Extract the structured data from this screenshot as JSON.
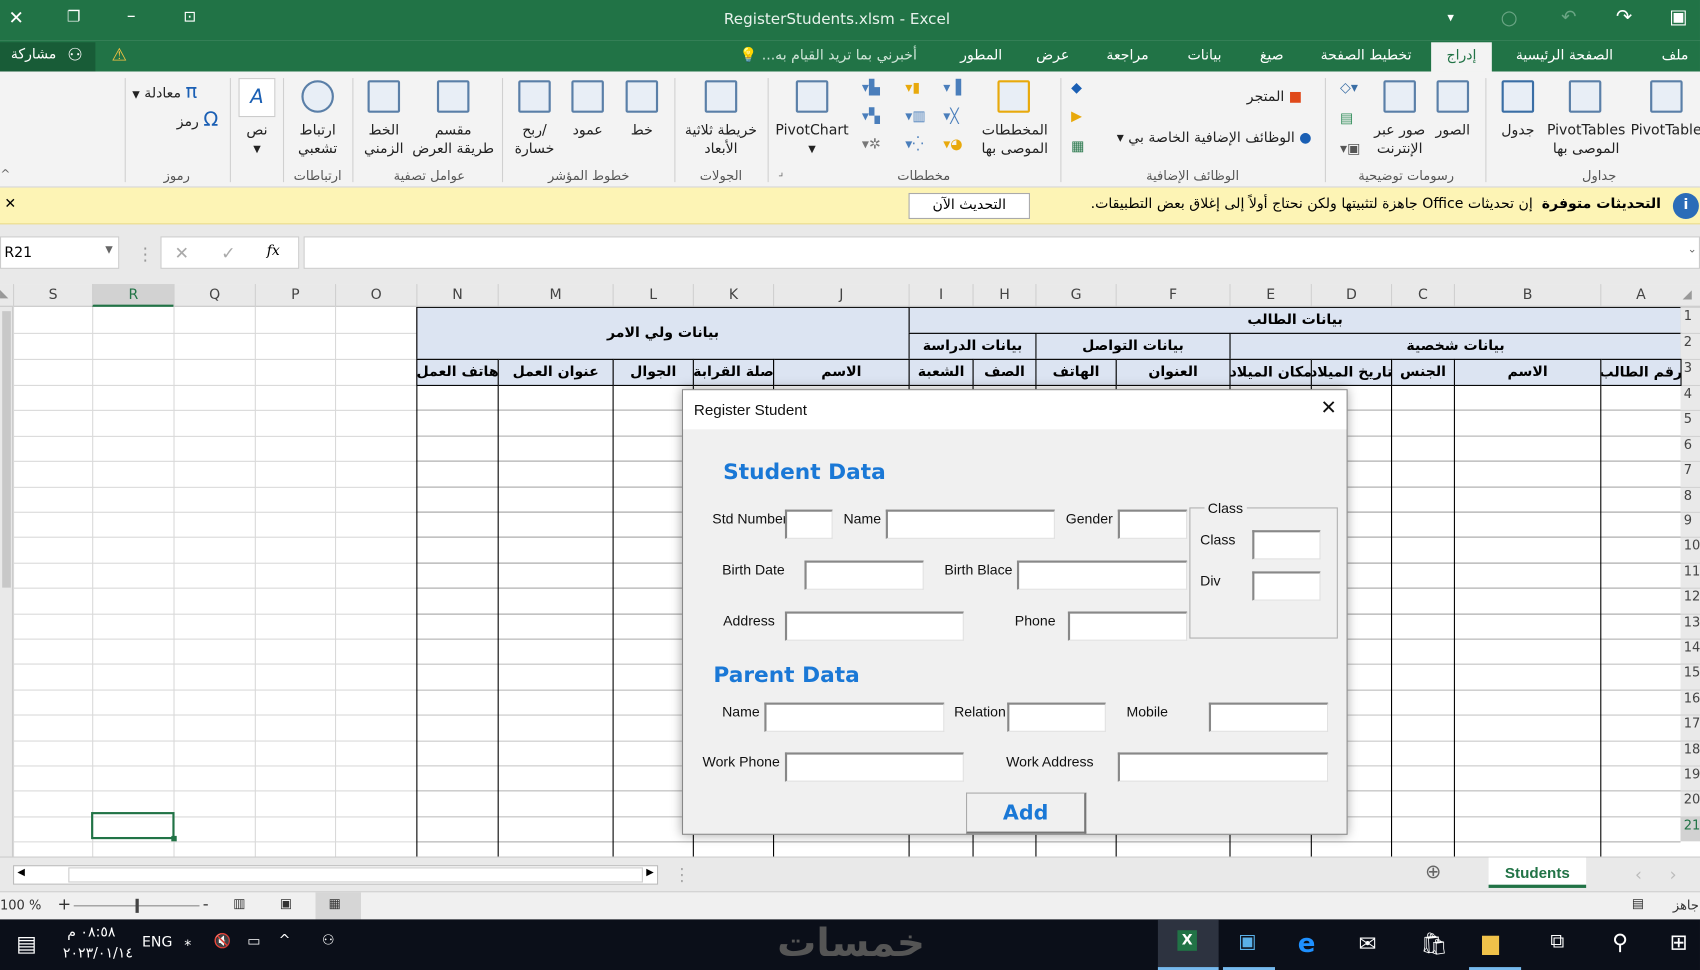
{
  "window": {
    "title": "RegisterStudents.xlsm - Excel"
  },
  "tabs": [
    {
      "label": "ملف"
    },
    {
      "label": "الصفحة الرئيسية"
    },
    {
      "label": "إدراج",
      "selected": true
    },
    {
      "label": "تخطيط الصفحة"
    },
    {
      "label": "صيغ"
    },
    {
      "label": "بيانات"
    },
    {
      "label": "مراجعة"
    },
    {
      "label": "عرض"
    },
    {
      "label": "المطور"
    }
  ],
  "tell_me": "أخبرني بما تريد القيام به...",
  "share": "مشاركة",
  "ribbon": {
    "groups": [
      "جداول",
      "رسومات توضيحية",
      "الوظائف الإضافية",
      "مخططات",
      "الجولات",
      "خطوط المؤشر",
      "عوامل تصفية",
      "ارتباطات",
      "رموز"
    ],
    "buttons": {
      "pivottable": "PivotTable",
      "rec_pivot1": "PivotTables",
      "rec_pivot2": "الموصى بها",
      "table": "جدول",
      "pictures": "الصور",
      "online1": "صور عبر",
      "online2": "الإنترنت",
      "store": "المتجر",
      "myaddins": "الوظائف الإضافية الخاصة بي",
      "rec_charts1": "المخططات",
      "rec_charts2": "الموصى بها",
      "pivotchart": "PivotChart",
      "map1": "خريطة ثلاثية",
      "map2": "الأبعاد",
      "line": "خط",
      "column": "عمود",
      "winloss1": "ربح/",
      "winloss2": "خسارة",
      "slicer1": "مقسم",
      "slicer2": "طريقة العرض",
      "timeline1": "الخط",
      "timeline2": "الزمني",
      "link1": "ارتباط",
      "link2": "تشعبي",
      "text": "نص",
      "equation": "معادلة",
      "symbol": "رمز"
    }
  },
  "banner": {
    "title": "التحديثات متوفرة",
    "message": "إن تحديثات Office جاهزة لتثبيتها ولكن نحتاج أولاً إلى إغلاق بعض التطبيقات.",
    "button": "التحديث الآن"
  },
  "formula_bar": {
    "name_box": "R21",
    "fx": "fx",
    "value": ""
  },
  "columns": [
    "S",
    "R",
    "Q",
    "P",
    "O",
    "N",
    "M",
    "L",
    "K",
    "J",
    "I",
    "H",
    "G",
    "F",
    "E",
    "D",
    "C",
    "B",
    "A"
  ],
  "rows": [
    "1",
    "2",
    "3",
    "4",
    "5",
    "6",
    "7",
    "8",
    "9",
    "10",
    "11",
    "12",
    "13",
    "14",
    "15",
    "16",
    "17",
    "18",
    "19",
    "20",
    "21"
  ],
  "sheet": {
    "student_header": "بيانات الطالب",
    "parent_header": "بيانات ولي الامر",
    "personal": "بيانات شخصية",
    "contact": "بيانات التواصل",
    "study": "بيانات الدراسة",
    "fields": {
      "A": "رقم الطالب",
      "B": "الاسم",
      "C": "الجنس",
      "D": "تاريخ الميلاد",
      "E": "مكان الميلاد",
      "F": "العنوان",
      "G": "الهاتف",
      "H": "الصف",
      "I": "الشعبة",
      "J": "الاسم",
      "K": "صلة القرابة",
      "L": "الجوال",
      "M": "عنوان العمل",
      "N": "هاتف العمل"
    },
    "selected_cell": "R21"
  },
  "sheet_tab": "Students",
  "status": {
    "ready": "جاهز",
    "zoom": "100 %",
    "zoom_level": 100
  },
  "taskbar": {
    "time": "٠٨:٥٨ م",
    "date": "٢٠٢٣/٠١/١٤",
    "lang": "ENG",
    "watermark": "خمسات"
  },
  "dialog": {
    "title": "Register Student",
    "student_heading": "Student Data",
    "parent_heading": "Parent Data",
    "labels": {
      "std_number": "Std Number",
      "name": "Name",
      "gender": "Gender",
      "birth_date": "Birth Date",
      "birth_place": "Birth Blace",
      "address": "Address",
      "phone": "Phone",
      "class_frame": "Class",
      "class": "Class",
      "div": "Div",
      "p_name": "Name",
      "relation": "Relation",
      "mobile": "Mobile",
      "work_phone": "Work Phone",
      "work_address": "Work Address"
    },
    "add": "Add"
  },
  "colors": {
    "excel_green": "#217346",
    "heading_blue": "#1a78d6",
    "header_fill": "#dce4f2",
    "banner": "#fdf4b5"
  }
}
